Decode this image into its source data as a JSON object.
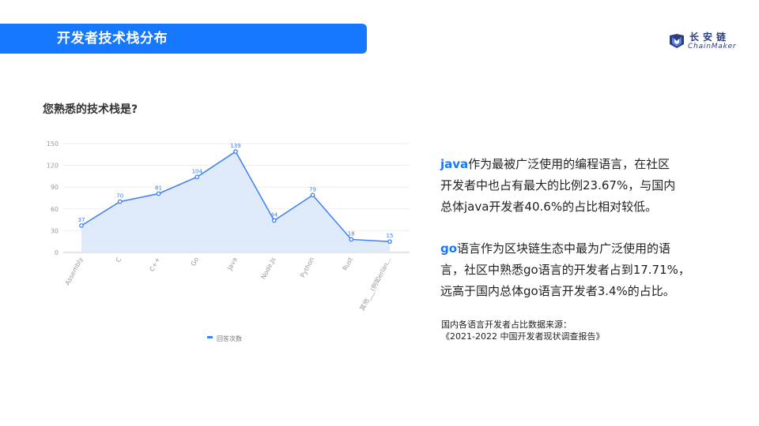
{
  "header": {
    "title": "开发者技术栈分布"
  },
  "logo": {
    "cn": "长安链",
    "en": "ChainMaker"
  },
  "question": "您熟悉的技术栈是?",
  "paragraph1": {
    "keyword": "java",
    "line1": "作为最被广泛使用的编程语言，在社区",
    "line2": "开发者中也占有最大的比例23.67%，与国内",
    "line3": "总体java开发者40.6%的占比相对较低。"
  },
  "paragraph2": {
    "keyword": "go",
    "line1": "语言作为区块链生态中最为广泛使用的语",
    "line2": "言，社区中熟悉go语言的开发者占到17.71%，",
    "line3": "远高于国内总体go语言开发者3.4%的占比。"
  },
  "source": {
    "line1": "国内各语言开发者占比数据来源：",
    "line2": "《2021-2022 中国开发者现状调查报告》"
  },
  "colors": {
    "accent": "#1677ff",
    "line": "#3d7ff5",
    "area": "#dbe8fb"
  },
  "chart_data": {
    "type": "area",
    "categories": [
      "Assembly",
      "C",
      "C++",
      "Go",
      "Java",
      "Node.Js",
      "Python",
      "Rust",
      "其他___(例如erlan..."
    ],
    "series": [
      {
        "name": "回答次数",
        "values": [
          37,
          70,
          81,
          104,
          139,
          44,
          79,
          18,
          15
        ]
      }
    ],
    "ylim": [
      0,
      150
    ],
    "yticks": [
      0,
      30,
      60,
      90,
      120,
      150
    ],
    "grid": true,
    "data_labels": true,
    "legend": "bottom-center",
    "xlabel": "",
    "ylabel": ""
  }
}
